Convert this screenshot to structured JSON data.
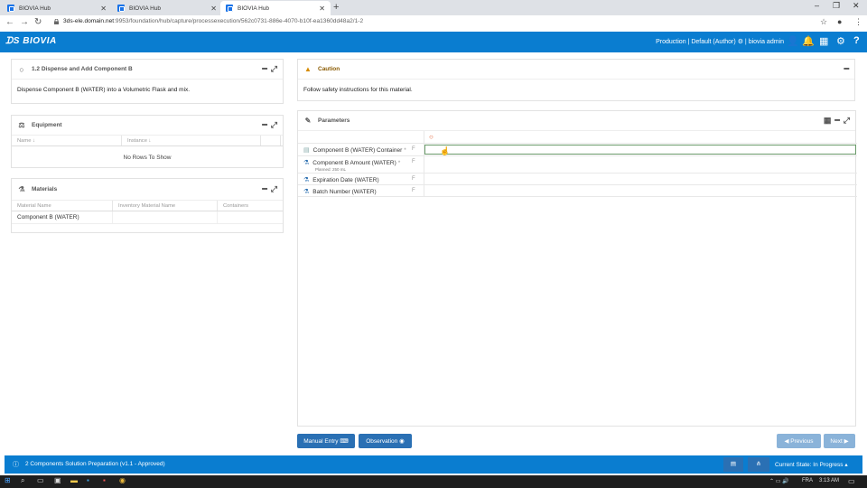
{
  "browser": {
    "tabs": [
      {
        "title": "BIOVIA Hub"
      },
      {
        "title": "BIOVIA Hub"
      },
      {
        "title": "BIOVIA Hub"
      }
    ],
    "url_host": "3ds-ele.domain.net",
    "url_path": ":9953/foundation/hub/capture/processexecution/562c0731-886e-4070-b10f-ea1360dd48a2/1-2"
  },
  "header": {
    "logo": "BIOVIA",
    "environment": "Production",
    "role": "Default (Author)",
    "user": "biovia admin"
  },
  "step_panel": {
    "title": "1.2 Dispense and Add Component B",
    "instruction": "Dispense Component B (WATER) into a Volumetric Flask and mix."
  },
  "caution_panel": {
    "title": "Caution",
    "text": "Follow safety instructions for this material."
  },
  "equipment_panel": {
    "title": "Equipment",
    "columns": [
      "Name",
      "Instance"
    ],
    "empty_text": "No Rows To Show"
  },
  "materials_panel": {
    "title": "Materials",
    "columns": [
      "Material Name",
      "Inventory Material Name",
      "Containers"
    ],
    "rows": [
      [
        "Component B (WATER)",
        "",
        ""
      ]
    ]
  },
  "parameters_panel": {
    "title": "Parameters",
    "rows": [
      {
        "label": "Component B (WATER) Container",
        "required": "*",
        "flag": "F",
        "sub": ""
      },
      {
        "label": "Component B Amount (WATER)",
        "required": "*",
        "flag": "F",
        "sub": "Planned: 250 mL"
      },
      {
        "label": "Expiration Date (WATER)",
        "required": "",
        "flag": "F",
        "sub": ""
      },
      {
        "label": "Batch Number (WATER)",
        "required": "",
        "flag": "F",
        "sub": ""
      }
    ]
  },
  "actions": {
    "manual_entry": "Manual Entry",
    "observation": "Observation",
    "previous": "Previous",
    "next": "Next"
  },
  "footer": {
    "process_name": "2 Components Solution Preparation (v1.1 - Approved)",
    "state": "Current State: In Progress"
  },
  "taskbar": {
    "language": "FRA",
    "time": "3:13 AM"
  },
  "colors": {
    "brand_blue": "#0a7dd0",
    "button_blue": "#2a70b4",
    "caution_orange": "#d68a00"
  }
}
